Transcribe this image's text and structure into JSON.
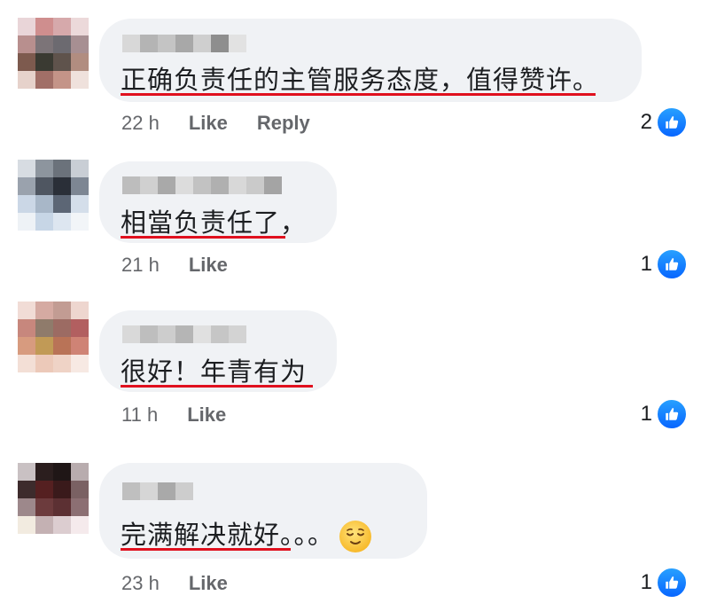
{
  "comments": [
    {
      "text": "正确负责任的主管服务态度，值得赞许。",
      "time": "22 h",
      "like_label": "Like",
      "reply_label": "Reply",
      "reaction_count": "2"
    },
    {
      "text": "相當负责任了，",
      "time": "21 h",
      "like_label": "Like",
      "reaction_count": "1"
    },
    {
      "text": "很好！年青有为",
      "time": "11 h",
      "like_label": "Like",
      "reaction_count": "1"
    },
    {
      "text": "完满解决就好。。。",
      "emoji": "relieved-face",
      "time": "23 h",
      "like_label": "Like",
      "reaction_count": "1"
    }
  ],
  "colors": {
    "bubble": "#f0f2f5",
    "underline": "#e0101e",
    "like_blue": "#0866ff",
    "meta_text": "#65676b"
  }
}
